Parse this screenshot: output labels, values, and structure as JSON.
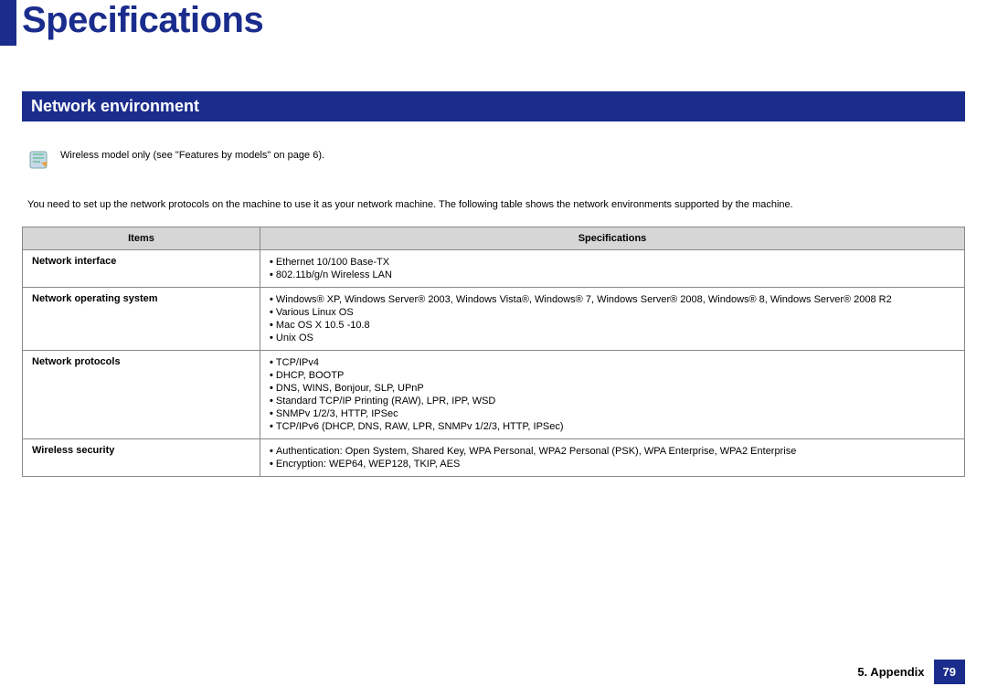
{
  "page": {
    "title": "Specifications",
    "section_header": "Network environment",
    "note": "Wireless model only (see \"Features by models\" on page 6).",
    "intro": "You need to set up the network protocols on the machine to use it as your network machine. The following table shows the network environments supported by the machine.",
    "footer_label": "5. Appendix",
    "page_number": "79"
  },
  "table": {
    "head_items": "Items",
    "head_specs": "Specifications",
    "rows": [
      {
        "item": "Network interface",
        "specs": [
          "Ethernet 10/100 Base-TX",
          "802.11b/g/n Wireless LAN"
        ]
      },
      {
        "item": "Network operating system",
        "specs": [
          "Windows® XP, Windows Server® 2003, Windows Vista®, Windows® 7, Windows Server® 2008, Windows® 8, Windows Server® 2008 R2",
          "Various Linux OS",
          "Mac OS X 10.5 -10.8",
          "Unix OS"
        ]
      },
      {
        "item": "Network protocols",
        "specs": [
          "TCP/IPv4",
          "DHCP, BOOTP",
          "DNS, WINS, Bonjour, SLP, UPnP",
          "Standard TCP/IP Printing (RAW), LPR, IPP, WSD",
          "SNMPv 1/2/3, HTTP, IPSec",
          "TCP/IPv6 (DHCP, DNS, RAW, LPR, SNMPv 1/2/3, HTTP, IPSec)"
        ]
      },
      {
        "item": "Wireless security",
        "specs": [
          "Authentication: Open System, Shared Key, WPA Personal, WPA2 Personal (PSK), WPA Enterprise, WPA2 Enterprise",
          "Encryption: WEP64, WEP128, TKIP, AES"
        ]
      }
    ]
  }
}
